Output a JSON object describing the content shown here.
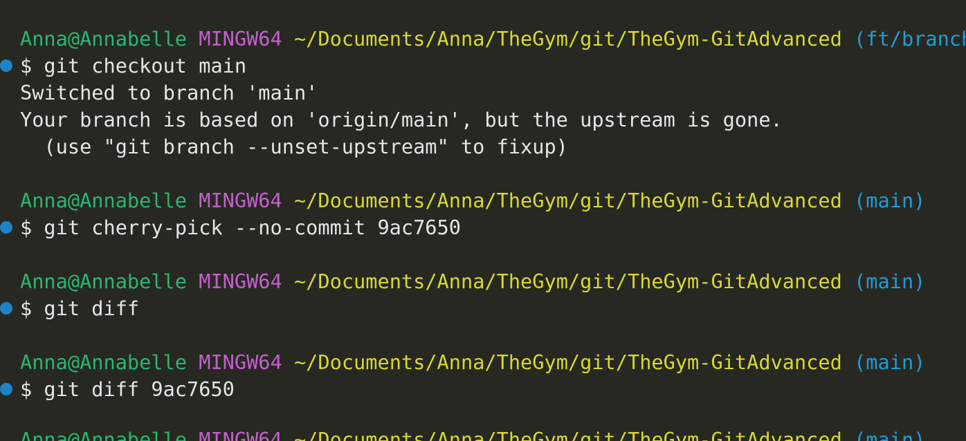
{
  "colors": {
    "background": "#272822",
    "text": "#e6e6e6",
    "user": "#2bb673",
    "host": "#c65fd0",
    "path": "#d8d832",
    "branch": "#1e9dd6",
    "marker": "#1e84c8"
  },
  "prompt": {
    "user": "Anna@Annabelle",
    "host": "MINGW64",
    "path": "~/Documents/Anna/TheGym/git/TheGym-GitAdvanced"
  },
  "blocks": [
    {
      "branch": "(ft/branch)",
      "command": "$ git checkout main",
      "output": [
        "Switched to branch 'main'",
        "Your branch is based on 'origin/main', but the upstream is gone.",
        "  (use \"git branch --unset-upstream\" to fixup)"
      ]
    },
    {
      "branch": "(main)",
      "command": "$ git cherry-pick --no-commit 9ac7650"
    },
    {
      "branch": "(main)",
      "command": "$ git diff"
    },
    {
      "branch": "(main)",
      "command": "$ git diff 9ac7650"
    },
    {
      "branch": "(main)"
    }
  ]
}
